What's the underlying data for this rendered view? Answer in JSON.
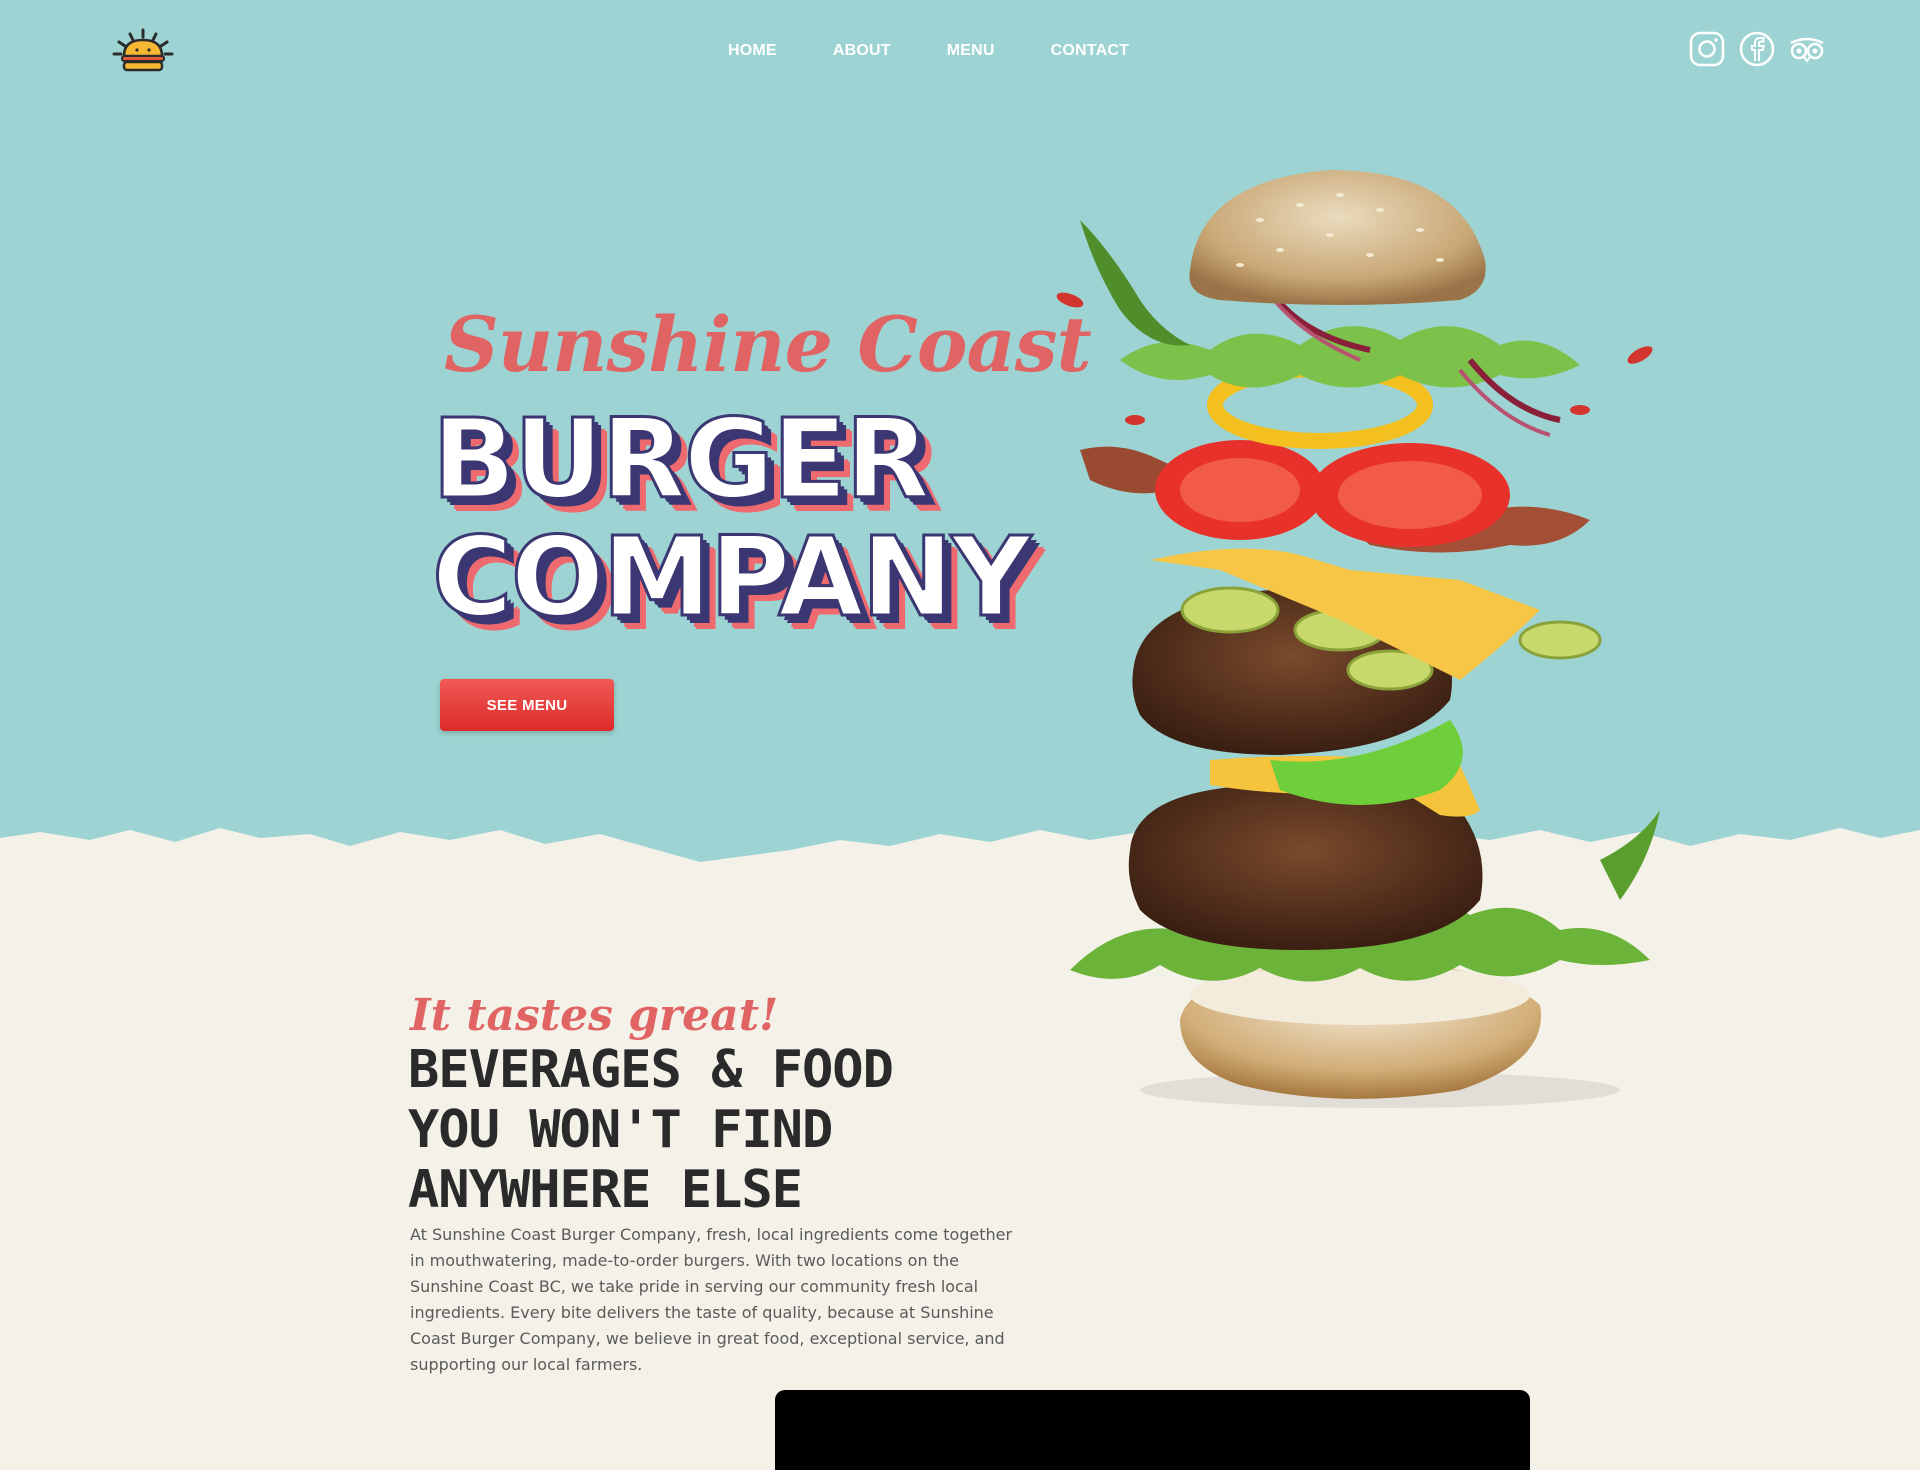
{
  "header": {
    "logo_icon": "burger-sun-logo",
    "nav": [
      "HOME",
      "ABOUT",
      "MENU",
      "CONTACT"
    ],
    "social": [
      {
        "name": "Instagram",
        "icon": "instagram-icon"
      },
      {
        "name": "Facebook",
        "icon": "facebook-icon"
      },
      {
        "name": "TripAdvisor",
        "icon": "tripadvisor-icon"
      }
    ]
  },
  "hero": {
    "script_title": "Sunshine Coast",
    "title_line1": "BURGER",
    "title_line2": "COMPANY",
    "cta_label": "SEE MENU",
    "image_subject": "burger-illustration"
  },
  "about": {
    "tagline": "It tastes great!",
    "heading": "BEVERAGES & FOOD YOU WON'T FIND ANYWHERE ELSE",
    "body": "At Sunshine Coast Burger Company, fresh, local ingredients come together in mouthwatering, made-to-order burgers. With two locations on the Sunshine Coast BC, we take pride in serving our community fresh local ingredients. Every bite delivers the taste of quality, because at Sunshine Coast Burger Company, we believe in great food, exceptional service, and supporting our local farmers."
  },
  "colors": {
    "hero_bg": "#9dd4d3",
    "cream": "#f4f1e9",
    "accent_red": "#e06464",
    "navy": "#3a3773",
    "button_red": "#e23a36"
  }
}
